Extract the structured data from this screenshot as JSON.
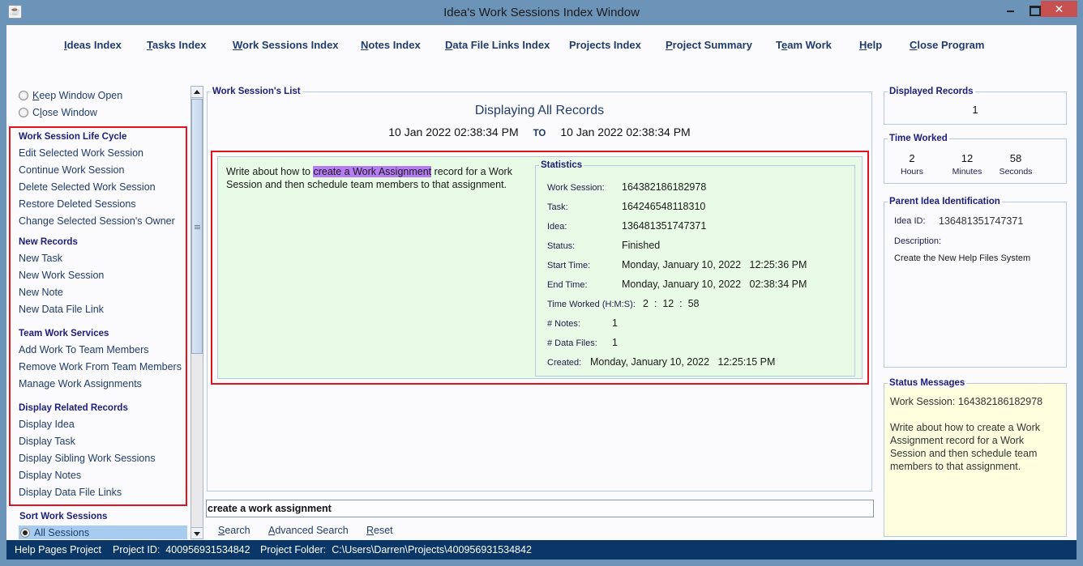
{
  "window": {
    "title": "Idea's Work Sessions Index Window",
    "app_icon": "java-coffee-icon",
    "controls": {
      "minimize": "minimize-icon",
      "maximize": "maximize-icon",
      "close": "✕"
    }
  },
  "menu": [
    {
      "mnemonic": "I",
      "rest": "deas Index"
    },
    {
      "mnemonic": "T",
      "rest": "asks Index"
    },
    {
      "mnemonic": "W",
      "rest": "ork Sessions Index"
    },
    {
      "mnemonic": "N",
      "rest": "otes Index"
    },
    {
      "mnemonic": "D",
      "rest": "ata File Links Index"
    },
    {
      "mnemonic": "",
      "rest": "Projects Index"
    },
    {
      "mnemonic": "P",
      "rest": "roject Summary"
    },
    {
      "pre": "T",
      "mnemonic": "e",
      "rest": "am Work"
    },
    {
      "mnemonic": "H",
      "rest": "elp"
    },
    {
      "mnemonic": "C",
      "rest": "lose Program"
    }
  ],
  "window_options": {
    "keep_open": {
      "mnemonic": "K",
      "rest": "eep Window Open"
    },
    "close_window": {
      "pre": "C",
      "mnemonic": "l",
      "rest": "ose Window"
    }
  },
  "sidebar": {
    "sections": [
      {
        "title": "Work Session Life Cycle",
        "items": [
          "Edit Selected Work Session",
          "Continue Work Session",
          "Delete Selected Work Session",
          "Restore Deleted Sessions",
          "Change Selected Session's Owner"
        ]
      },
      {
        "title": "New Records",
        "items": [
          "New Task",
          "New Work Session",
          "New Note",
          "New Data File Link"
        ]
      },
      {
        "title": "Team Work Services",
        "items": [
          "Add Work To Team Members",
          "Remove Work From Team Members",
          "Manage Work Assignments"
        ]
      },
      {
        "title": "Display Related Records",
        "items": [
          "Display Idea",
          "Display Task",
          "Display Sibling Work Sessions",
          "Display Notes",
          "Display Data File Links"
        ]
      }
    ],
    "sort": {
      "title": "Sort Work Sessions",
      "selected": "All Sessions"
    }
  },
  "list": {
    "group_title": "Work Session's List",
    "heading": "Displaying All Records",
    "date_from": "10 Jan 2022  02:38:34 PM",
    "to_label": "TO",
    "date_to": "10 Jan 2022  02:38:34 PM",
    "record": {
      "text_before": "Write about how to ",
      "text_highlight": "create a Work Assignment",
      "text_after": " record for a Work Session and then schedule team members to that assignment.",
      "highlight_color": "#b57cf4",
      "statistics": {
        "title": "Statistics",
        "work_session_label": "Work Session:",
        "work_session": "164382186182978",
        "task_label": "Task:",
        "task": "164246548118310",
        "idea_label": "Idea:",
        "idea": "136481351747371",
        "status_label": "Status:",
        "status": "Finished",
        "start_label": "Start Time:",
        "start": "Monday, January 10, 2022   12:25:36 PM",
        "end_label": "End Time:",
        "end": "Monday, January 10, 2022   02:38:34 PM",
        "worked_label": "Time Worked (H:M:S):",
        "worked": "2  :  12  :  58",
        "notes_label": "# Notes:",
        "notes": "1",
        "files_label": "# Data Files:",
        "files": "1",
        "created_label": "Created:",
        "created": "Monday, January 10, 2022   12:25:15 PM"
      }
    }
  },
  "search": {
    "value": "create a work assignment",
    "buttons": [
      {
        "mnemonic": "S",
        "rest": "earch"
      },
      {
        "mnemonic": "A",
        "rest": "dvanced Search"
      },
      {
        "mnemonic": "R",
        "rest": "eset"
      }
    ]
  },
  "right": {
    "displayed_records": {
      "title": "Displayed Records",
      "value": "1"
    },
    "time_worked": {
      "title": "Time Worked",
      "hours": "2",
      "hours_label": "Hours",
      "minutes": "12",
      "minutes_label": "Minutes",
      "seconds": "58",
      "seconds_label": "Seconds"
    },
    "parent_idea": {
      "title": "Parent Idea Identification",
      "id_label": "Idea ID:",
      "id": "136481351747371",
      "desc_label": "Description:",
      "description": "Create the New Help Files System"
    },
    "status_messages": {
      "title": "Status Messages",
      "text": "Work Session: 164382186182978\n\nWrite about how to create a Work Assignment record for a Work Session and then schedule team members to that assignment."
    }
  },
  "statusbar": {
    "project": "Help Pages Project",
    "project_id": "Project ID:  400956931534842",
    "folder": "Project Folder:  C:\\Users\\Darren\\Projects\\400956931534842"
  }
}
